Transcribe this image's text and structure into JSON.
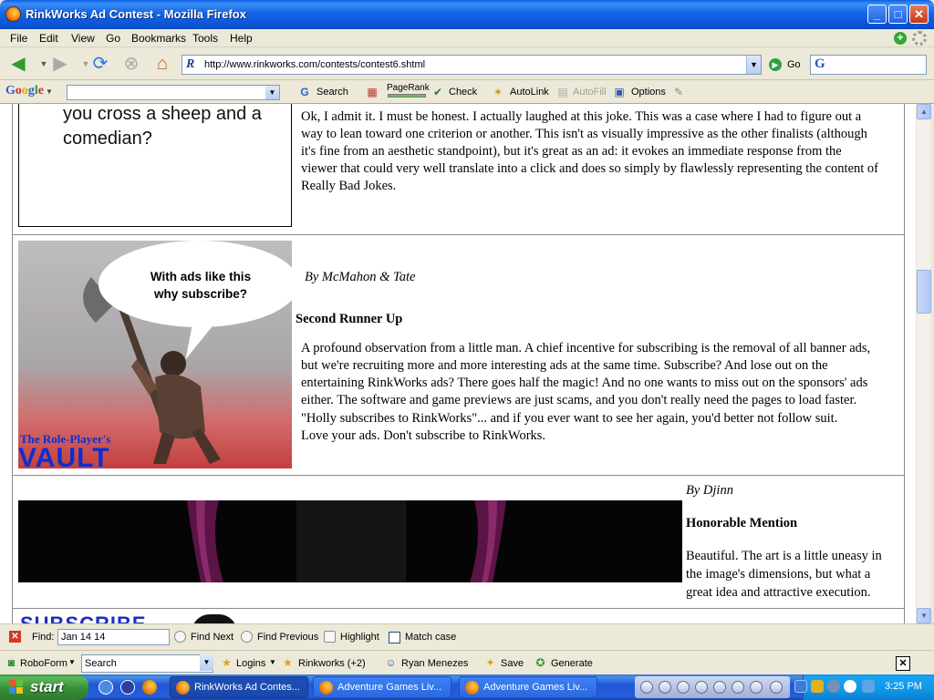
{
  "window": {
    "title": "RinkWorks Ad Contest - Mozilla Firefox",
    "min": "_",
    "max": "□",
    "close": "✕"
  },
  "menu": [
    "File",
    "Edit",
    "View",
    "Go",
    "Bookmarks",
    "Tools",
    "Help"
  ],
  "nav": {
    "url": "http://www.rinkworks.com/contests/contest6.shtml",
    "go_label": "Go"
  },
  "google_toolbar": {
    "logo": [
      "G",
      "o",
      "o",
      "g",
      "l",
      "e"
    ],
    "search_label": "Search",
    "pagerank_label": "PageRank",
    "check_label": "Check",
    "autolink_label": "AutoLink",
    "autofill_label": "AutoFill",
    "options_label": "Options"
  },
  "content": {
    "ad1_text": [
      "you cross a sheep and a",
      "comedian?"
    ],
    "entry1_review": [
      " Ok, I admit it. I must be honest. I actually laughed at this joke. This was a case where I had to figure out a",
      "way to lean toward one criterion or another. This isn't as visually impressive as the other finalists (although",
      "it's fine from an aesthetic standpoint), but it's great as an ad: it evokes an immediate response from the",
      "viewer that could very well translate into a click and does so simply by flawlessly representing the content of",
      "Really Bad Jokes."
    ],
    "ad2_bubble": [
      "With ads like this",
      "why subscribe?"
    ],
    "ad2_brand_small": "The Role-Player's",
    "ad2_brand_big": "VAULT",
    "entry2_author": "By McMahon & Tate",
    "entry2_award": "Second Runner Up",
    "entry2_review": [
      "A profound observation from a little man. A chief incentive for subscribing is the removal of all banner ads,",
      "but we're recruiting more and more interesting ads at the  same time. Subscribe? And lose out on the",
      "entertaining RinkWorks ads? There goes half the magic! And no one wants to miss out on the sponsors' ads",
      "either. The software and game previews are just scams, and you don't really need the pages to load faster.",
      "\"Holly subscribes to RinkWorks\"... and if you ever want to see her again, you'd better not follow suit.",
      " Love your ads. Don't subscribe to RinkWorks."
    ],
    "entry3_author": "By Djinn",
    "entry3_award": "Honorable Mention",
    "entry3_review": [
      "Beautiful. The art is a little uneasy in",
      "the image's dimensions, but what a",
      "great idea and attractive execution."
    ],
    "ad4_peek": "SUBSCRIBE"
  },
  "findbar": {
    "label": "Find:",
    "value": "Jan 14 14",
    "find_next": "Find Next",
    "find_previous": "Find Previous",
    "highlight": "Highlight",
    "match_case": "Match case"
  },
  "roboform": {
    "name": "RoboForm",
    "search_value": "Search",
    "logins": "Logins",
    "rinkworks": "Rinkworks (+2)",
    "person": "Ryan Menezes",
    "save": "Save",
    "generate": "Generate"
  },
  "taskbar": {
    "start": "start",
    "tasks": [
      "RinkWorks Ad Contes...",
      "Adventure Games Liv...",
      "Adventure Games Liv..."
    ],
    "clock": "3:25 PM"
  }
}
